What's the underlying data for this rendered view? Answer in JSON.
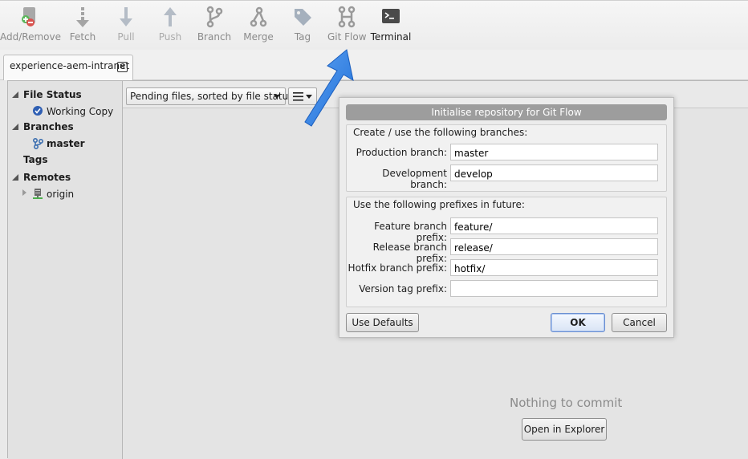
{
  "toolbar": {
    "items": [
      {
        "label": "Add/Remove",
        "icon": "add-remove-icon",
        "state": "normal"
      },
      {
        "label": "Fetch",
        "icon": "fetch-icon",
        "state": "normal"
      },
      {
        "label": "Pull",
        "icon": "pull-icon",
        "state": "disabled"
      },
      {
        "label": "Push",
        "icon": "push-icon",
        "state": "disabled"
      },
      {
        "label": "Branch",
        "icon": "branch-icon",
        "state": "normal"
      },
      {
        "label": "Merge",
        "icon": "merge-icon",
        "state": "normal"
      },
      {
        "label": "Tag",
        "icon": "tag-icon",
        "state": "normal"
      },
      {
        "label": "Git Flow",
        "icon": "git-flow-icon",
        "state": "normal"
      },
      {
        "label": "Terminal",
        "icon": "terminal-icon",
        "state": "active"
      }
    ]
  },
  "tab": {
    "label": "experience-aem-intranet",
    "close": "✕"
  },
  "sidebar": {
    "file_status": "File Status",
    "working_copy": "Working Copy",
    "branches": "Branches",
    "master": "master",
    "tags": "Tags",
    "remotes": "Remotes",
    "origin": "origin"
  },
  "filterbar": {
    "sort_label": "Pending files, sorted by file status"
  },
  "content": {
    "empty_text": "Nothing to commit",
    "explorer_button": "Open in Explorer"
  },
  "dialog": {
    "title": "Initialise repository for Git Flow",
    "branches_group": "Create / use the following branches:",
    "production_label": "Production branch:",
    "production_value": "master",
    "development_label": "Development branch:",
    "development_value": "develop",
    "prefixes_group": "Use the following prefixes in future:",
    "feature_label": "Feature branch prefix:",
    "feature_value": "feature/",
    "release_label": "Release branch prefix:",
    "release_value": "release/",
    "hotfix_label": "Hotfix branch prefix:",
    "hotfix_value": "hotfix/",
    "version_label": "Version tag prefix:",
    "version_value": "",
    "use_defaults": "Use Defaults",
    "ok": "OK",
    "cancel": "Cancel"
  },
  "colors": {
    "accent_arrow": "#2f7fe6",
    "dialog_title_bg": "#9d9d9d"
  }
}
